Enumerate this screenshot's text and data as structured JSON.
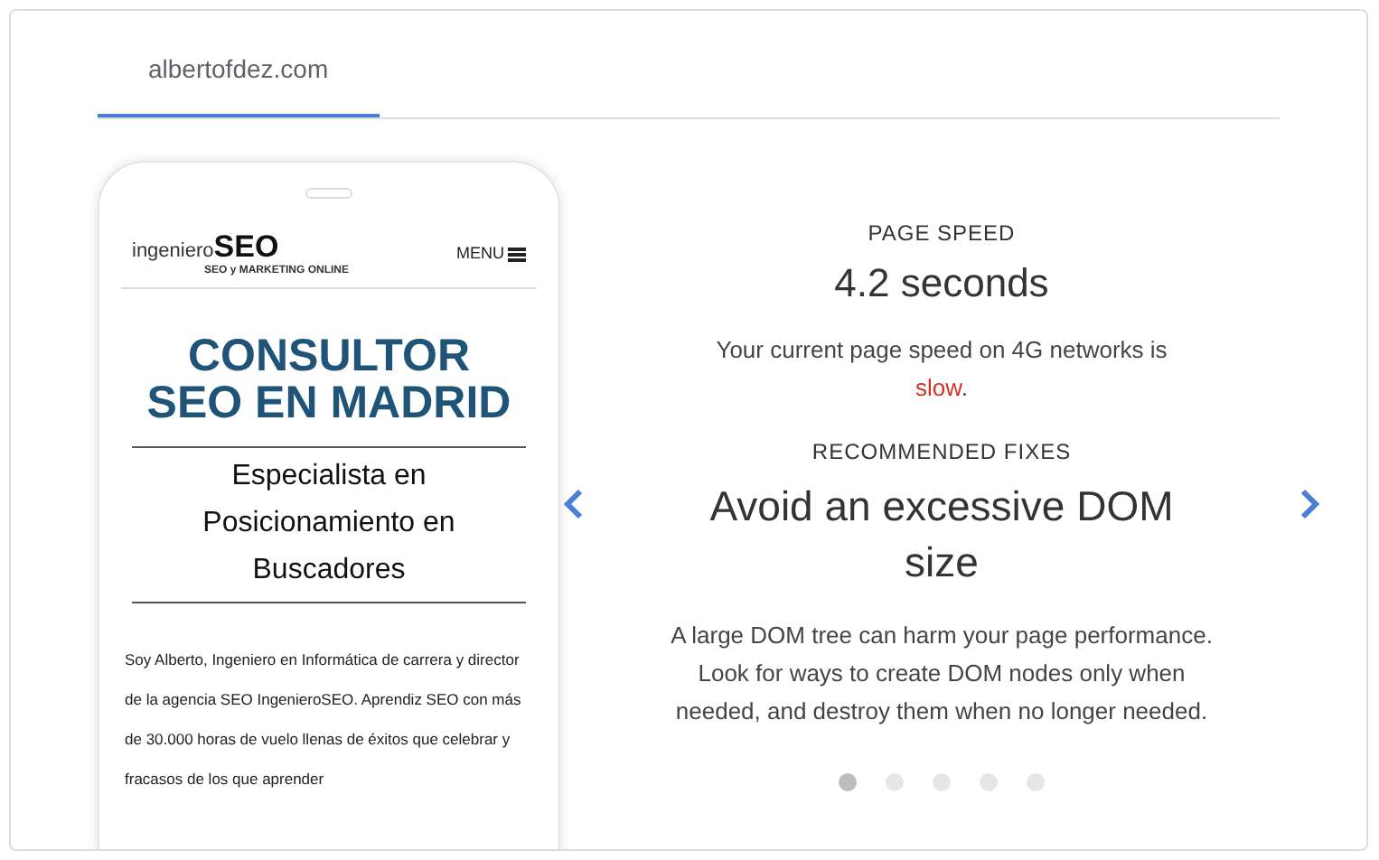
{
  "tabs": [
    {
      "label": "albertofdez.com",
      "selected": true
    }
  ],
  "phone": {
    "logo_light": "ingeniero",
    "logo_bold": "SEO",
    "logo_tagline": "SEO y MARKETING ONLINE",
    "menu": "MENU",
    "headline": "CONSULTOR SEO EN MADRID",
    "subheadline": "Especialista en Posicionamiento en Buscadores",
    "body": "Soy Alberto, Ingeniero en Informática de carrera y director de la agencia SEO IngenieroSEO. Aprendiz SEO con más de 30.000 horas de vuelo llenas de éxitos que celebrar y fracasos de los que aprender"
  },
  "speed": {
    "label": "PAGE SPEED",
    "value": "4.2 seconds",
    "description": "Your current page speed on 4G networks is ",
    "rating": "slow",
    "rating_end": "."
  },
  "fixes": {
    "label": "RECOMMENDED FIXES",
    "title": "Avoid an excessive DOM size",
    "description": "A large DOM tree can harm your page performance. Look for ways to create DOM nodes only when needed, and destroy them when no longer needed.",
    "dots": [
      {
        "selected": true
      },
      {
        "selected": false
      },
      {
        "selected": false
      },
      {
        "selected": false
      },
      {
        "selected": false
      }
    ]
  }
}
